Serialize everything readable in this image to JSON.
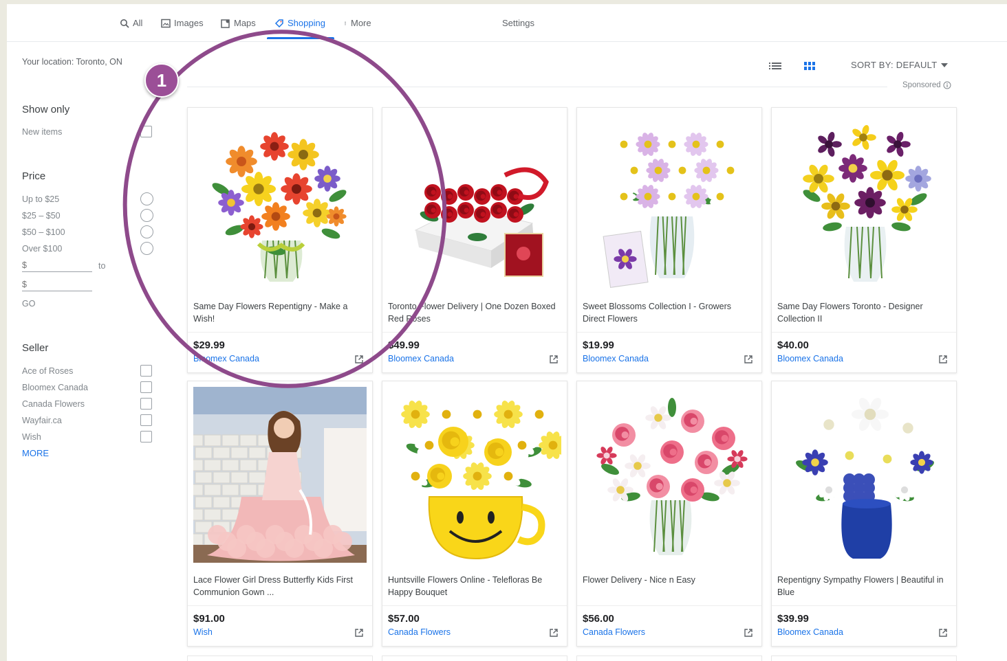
{
  "nav": {
    "tabs": [
      {
        "label": "All",
        "icon": "search-icon"
      },
      {
        "label": "Images",
        "icon": "image-icon"
      },
      {
        "label": "Maps",
        "icon": "map-icon"
      },
      {
        "label": "Shopping",
        "icon": "shopping-tag-icon",
        "active": true
      },
      {
        "label": "More",
        "icon": "vertical-dots-icon"
      }
    ],
    "settings_label": "Settings"
  },
  "sidebar": {
    "location": "Your location: Toronto, ON",
    "show_only": {
      "heading": "Show only",
      "items": [
        "New items"
      ]
    },
    "price": {
      "heading": "Price",
      "options": [
        "Up to $25",
        "$25 – $50",
        "$50 – $100",
        "Over $100"
      ],
      "min_placeholder": "$",
      "to_label": "to",
      "max_placeholder": "$",
      "go_label": "GO"
    },
    "seller": {
      "heading": "Seller",
      "items": [
        "Ace of Roses",
        "Bloomex Canada",
        "Canada Flowers",
        "Wayfair.ca",
        "Wish"
      ],
      "more_label": "MORE"
    }
  },
  "toolbar": {
    "list_view_icon": "list-view-icon",
    "grid_view_icon": "grid-view-icon",
    "sort_label": "SORT BY: DEFAULT",
    "sponsored_label": "Sponsored"
  },
  "products": [
    {
      "title": "Same Day Flowers Repentigny - Make a Wish!",
      "price": "$29.99",
      "seller": "Bloomex Canada",
      "image": "mixed-flower-bouquet-image"
    },
    {
      "title": "Toronto Flower Delivery | One Dozen Boxed Red Roses",
      "price": "$49.99",
      "seller": "Bloomex Canada",
      "image": "boxed-red-roses-image"
    },
    {
      "title": "Sweet Blossoms Collection I - Growers Direct Flowers",
      "price": "$19.99",
      "seller": "Bloomex Canada",
      "image": "daisy-vase-with-card-image"
    },
    {
      "title": "Same Day Flowers Toronto - Designer Collection II",
      "price": "$40.00",
      "seller": "Bloomex Canada",
      "image": "yellow-purple-bouquet-image"
    },
    {
      "title": "Lace Flower Girl Dress Butterfly Kids First Communion Gown ...",
      "price": "$91.00",
      "seller": "Wish",
      "image": "pink-girl-dress-image"
    },
    {
      "title": "Huntsville Flowers Online - Telefloras Be Happy Bouquet",
      "price": "$57.00",
      "seller": "Canada Flowers",
      "image": "smiley-mug-bouquet-image"
    },
    {
      "title": "Flower Delivery - Nice n Easy",
      "price": "$56.00",
      "seller": "Canada Flowers",
      "image": "pink-carnation-vase-image"
    },
    {
      "title": "Repentigny Sympathy Flowers | Beautiful in Blue",
      "price": "$39.99",
      "seller": "Bloomex Canada",
      "image": "blue-white-vase-image"
    }
  ],
  "annotation": {
    "badge": "1",
    "color": "#9b4f97"
  },
  "colors": {
    "accent": "#1a73e8",
    "background": "#ebeae0",
    "annotation": "#8e4a8b"
  }
}
